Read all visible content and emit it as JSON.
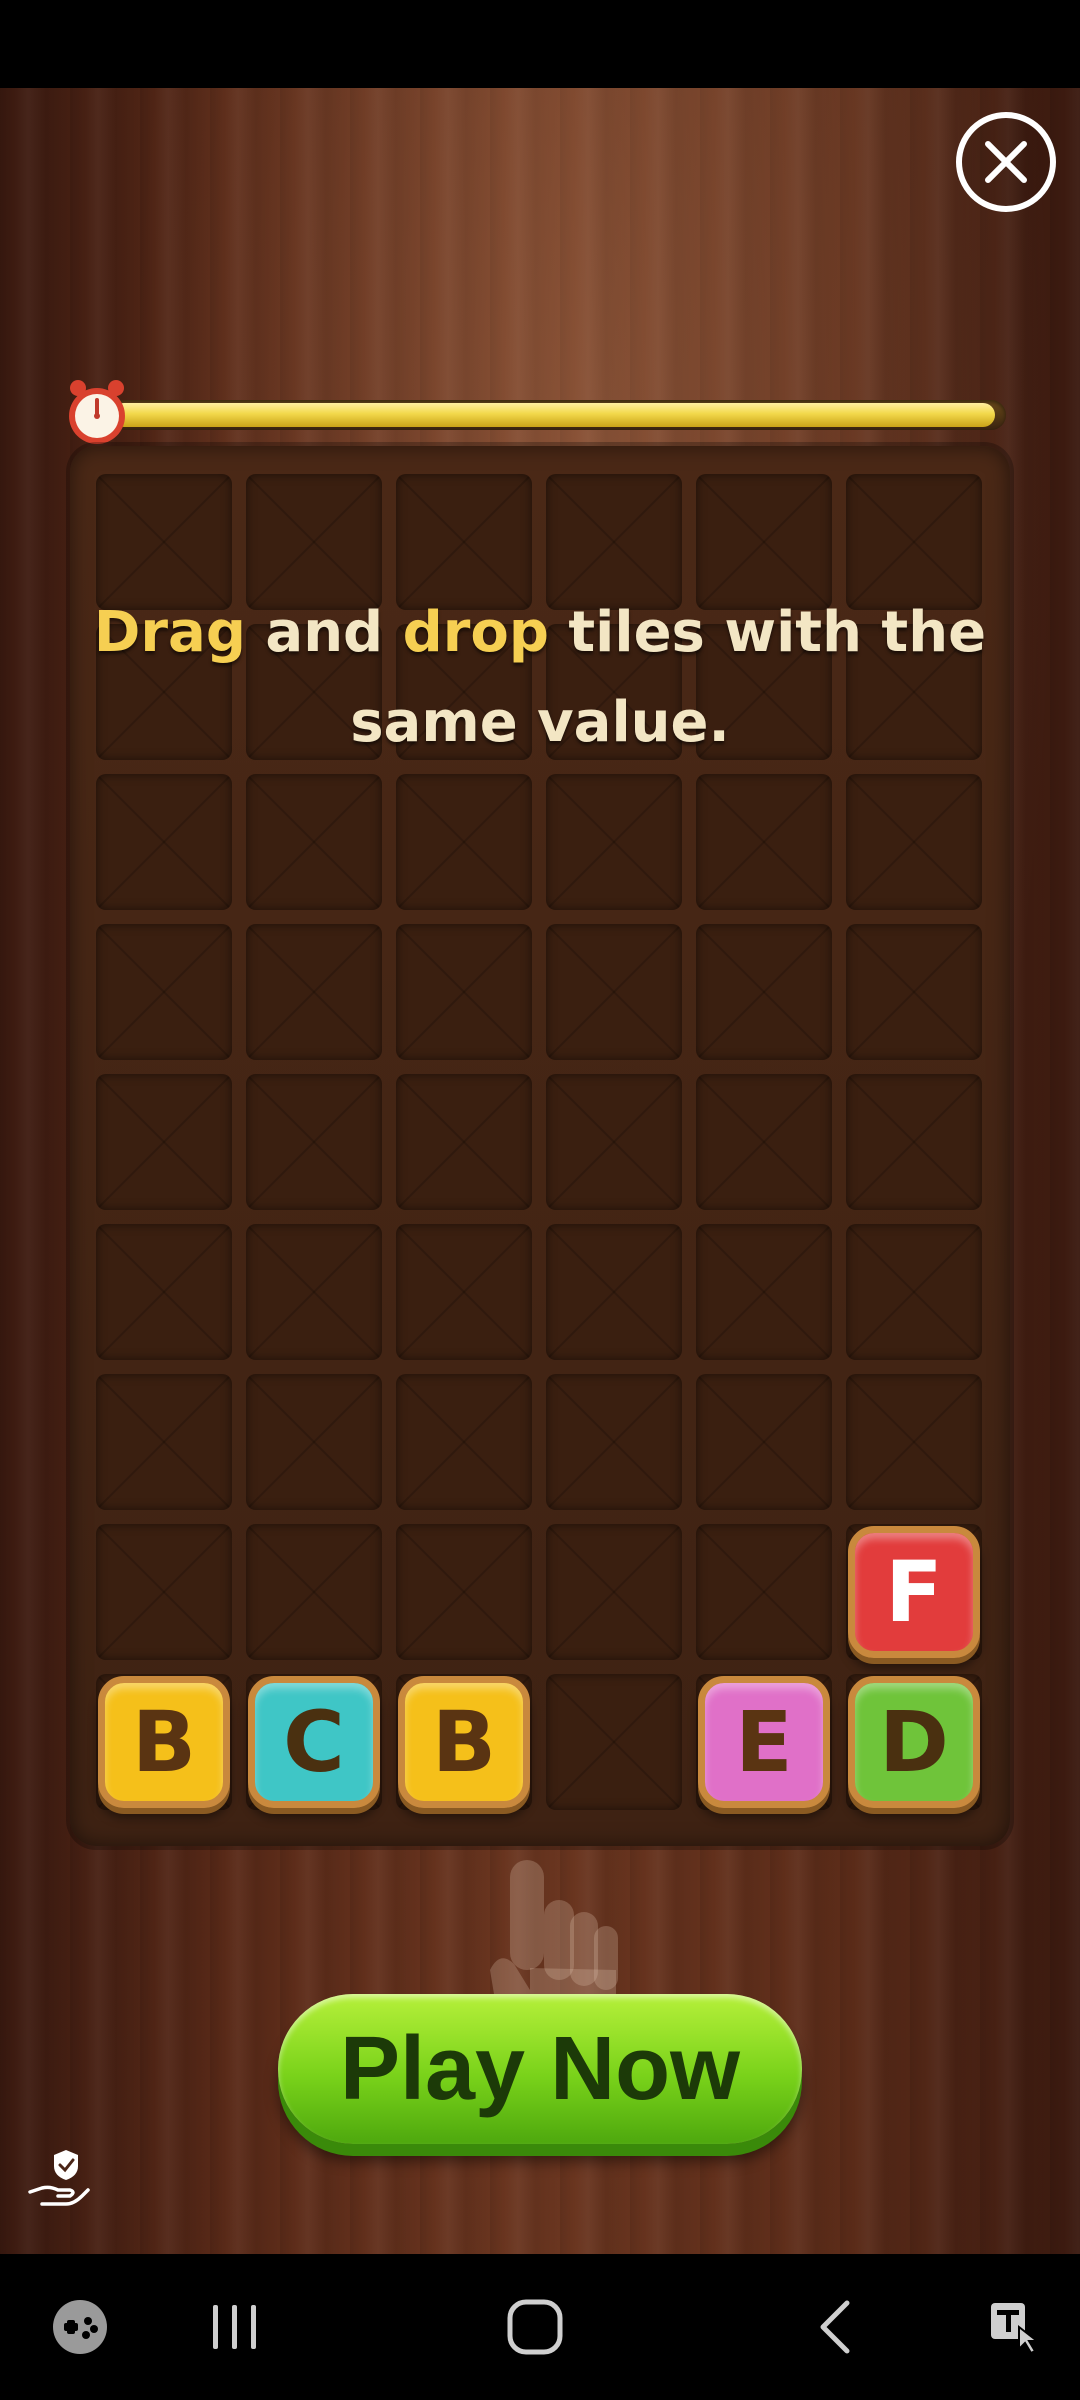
{
  "game": {
    "instruction_parts": [
      {
        "text": "Drag",
        "highlight": true
      },
      {
        "text": " and ",
        "highlight": false
      },
      {
        "text": "drop",
        "highlight": true
      },
      {
        "text": " tiles with the same value.",
        "highlight": false
      }
    ],
    "timer_remaining_fraction": 0.99,
    "grid": {
      "columns": 6,
      "rows": 9
    },
    "tiles": [
      {
        "letter": "F",
        "row": 7,
        "col": 5,
        "color": "#e23c3c",
        "text_color": "#ffffff"
      },
      {
        "letter": "B",
        "row": 8,
        "col": 0,
        "color": "#f5c01a",
        "text_color": "#5a3412"
      },
      {
        "letter": "C",
        "row": 8,
        "col": 1,
        "color": "#3fc6c6",
        "text_color": "#4a3010"
      },
      {
        "letter": "B",
        "row": 8,
        "col": 2,
        "color": "#f5c01a",
        "text_color": "#5a3412"
      },
      {
        "letter": "E",
        "row": 8,
        "col": 4,
        "color": "#e070c8",
        "text_color": "#5a3412"
      },
      {
        "letter": "D",
        "row": 8,
        "col": 5,
        "color": "#6fc43a",
        "text_color": "#4a3010"
      }
    ],
    "play_button_label": "Play Now"
  },
  "icons": {
    "close": "close-icon",
    "timer": "alarm-clock-icon",
    "hint": "pointing-hand-icon",
    "privacy": "hand-shield-icon"
  },
  "nav": {
    "items": [
      "game-launcher-icon",
      "recent-apps-icon",
      "home-icon",
      "back-icon",
      "accessibility-icon"
    ]
  },
  "colors": {
    "timer_fill": "#f2d84a",
    "play_button": "#79d21a",
    "instruction_highlight": "#f6cf52"
  }
}
